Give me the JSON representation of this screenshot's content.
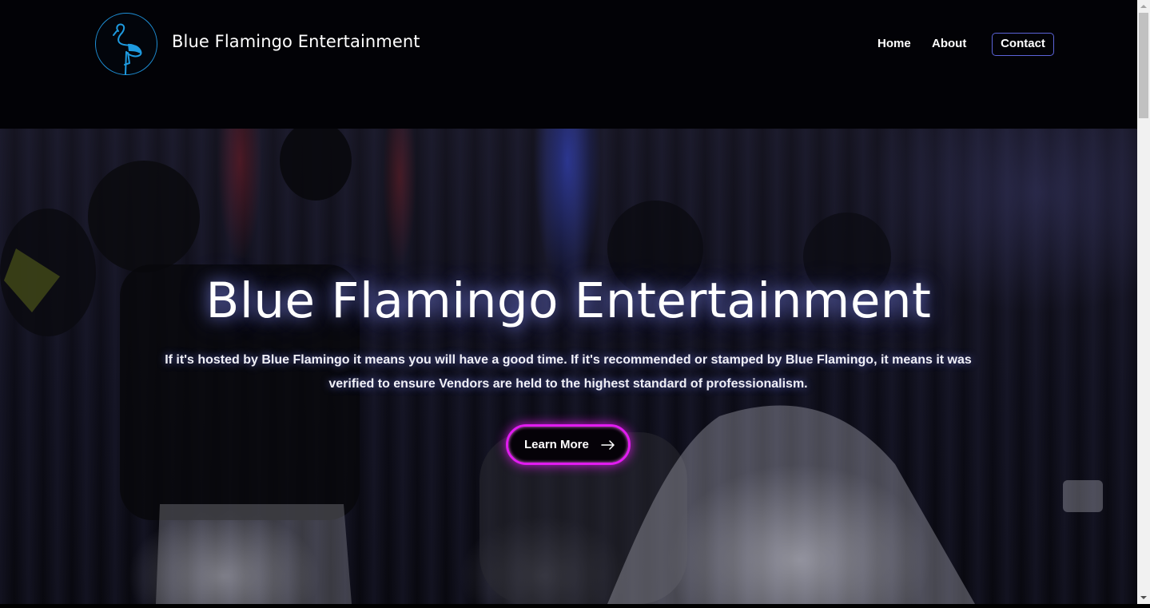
{
  "header": {
    "brand": "Blue Flamingo Entertainment",
    "logo_icon": "flamingo-icon",
    "nav": {
      "home": "Home",
      "about": "About",
      "contact": "Contact"
    }
  },
  "hero": {
    "title": "Blue Flamingo Entertainment",
    "description": "If it's hosted by Blue Flamingo it means you will have a good time. If it's recommended or stamped by Blue Flamingo, it means it was verified to ensure Vendors are held to the highest standard of professionalism.",
    "button_label": "Learn More",
    "button_icon": "arrow-right-icon"
  },
  "colors": {
    "accent_blue": "#1e8fd6",
    "contact_border": "#5b63d8",
    "button_glow": "#e11cf0",
    "background": "#020206"
  }
}
